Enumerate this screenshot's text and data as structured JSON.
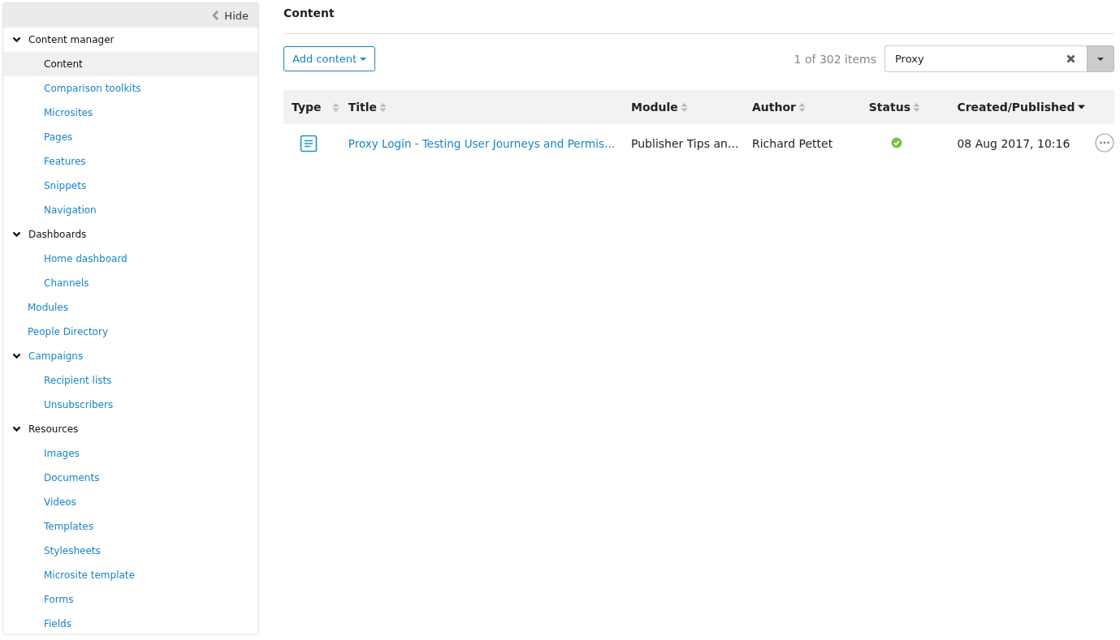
{
  "sidebar": {
    "hide_label": "Hide",
    "items": [
      {
        "label": "Content manager",
        "kind": "heading",
        "expanded": true,
        "children": [
          {
            "label": "Content",
            "selected": true
          },
          {
            "label": "Comparison toolkits",
            "selected": false
          },
          {
            "label": "Microsites",
            "selected": false
          },
          {
            "label": "Pages",
            "selected": false
          },
          {
            "label": "Features",
            "selected": false
          },
          {
            "label": "Snippets",
            "selected": false
          },
          {
            "label": "Navigation",
            "selected": false
          }
        ]
      },
      {
        "label": "Dashboards",
        "kind": "heading",
        "expanded": true,
        "children": [
          {
            "label": "Home dashboard",
            "selected": false
          },
          {
            "label": "Channels",
            "selected": false
          }
        ]
      },
      {
        "label": "Modules",
        "kind": "link"
      },
      {
        "label": "People Directory",
        "kind": "link"
      },
      {
        "label": "Campaigns",
        "kind": "link",
        "expanded": true,
        "children": [
          {
            "label": "Recipient lists",
            "selected": false
          },
          {
            "label": "Unsubscribers",
            "selected": false
          }
        ]
      },
      {
        "label": "Resources",
        "kind": "heading",
        "expanded": true,
        "children": [
          {
            "label": "Images",
            "selected": false
          },
          {
            "label": "Documents",
            "selected": false
          },
          {
            "label": "Videos",
            "selected": false
          },
          {
            "label": "Templates",
            "selected": false
          },
          {
            "label": "Stylesheets",
            "selected": false
          },
          {
            "label": "Microsite template",
            "selected": false
          },
          {
            "label": "Forms",
            "selected": false
          },
          {
            "label": "Fields",
            "selected": false
          }
        ]
      }
    ]
  },
  "page_title": "Content",
  "add_button": "Add content",
  "item_count": "1 of 302 items",
  "search": {
    "value": "Proxy"
  },
  "table": {
    "columns": [
      {
        "label": "Type",
        "kind": "sortable"
      },
      {
        "label": "Title",
        "kind": "sortable"
      },
      {
        "label": "Module",
        "kind": "sortable"
      },
      {
        "label": "Author",
        "kind": "sortable"
      },
      {
        "label": "Status",
        "kind": "sortable"
      },
      {
        "label": "Created/Published",
        "kind": "sorted-desc"
      }
    ],
    "rows": [
      {
        "kind": "document",
        "title": "Proxy Login - Testing User Journeys and Permis…",
        "module": "Publisher Tips an…",
        "author": "Richard Pettet",
        "published": true,
        "created": "08 Aug 2017, 10:16"
      }
    ]
  }
}
